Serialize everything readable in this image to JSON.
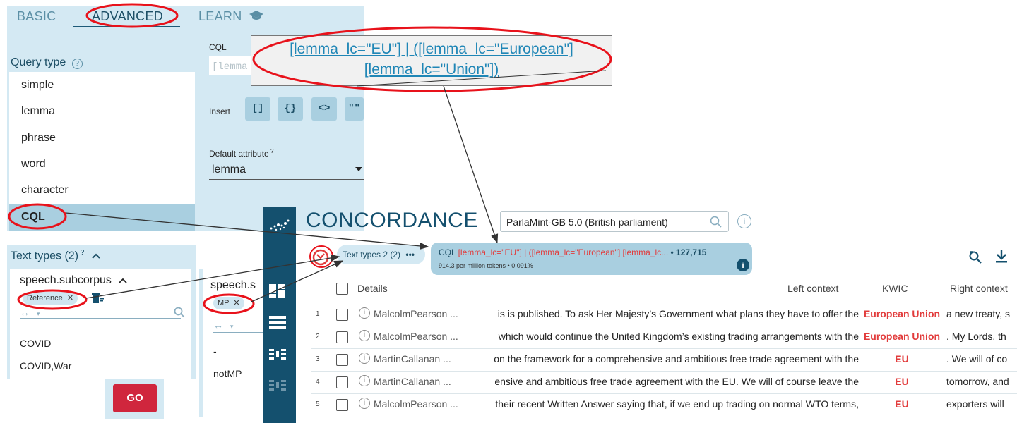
{
  "search_panel": {
    "tabs": [
      {
        "label": "BASIC"
      },
      {
        "label": "ADVANCED"
      },
      {
        "label": "LEARN"
      }
    ],
    "query_type_label": "Query type",
    "query_types": [
      "simple",
      "lemma",
      "phrase",
      "word",
      "character",
      "CQL"
    ],
    "selected_query_type": "CQL",
    "cql_label": "CQL",
    "cql_placeholder": "[lemma",
    "insert_label": "Insert",
    "insert_buttons": [
      "[]",
      "{}",
      "<>",
      "\"\""
    ],
    "default_attr_label": "Default attribute",
    "default_attr_value": "lemma"
  },
  "cql_overlay": {
    "line1": "[lemma_lc=\"EU\"] | ([lemma_lc=\"European\"]",
    "line2": "[lemma_lc=\"Union\"])"
  },
  "text_types": {
    "header": "Text types (2)",
    "attr1": "speech.subcorpus",
    "attr1_chip": "Reference",
    "attr1_values": [
      "COVID",
      "COVID,War"
    ],
    "attr2": "speech.s",
    "attr2_chip": "MP",
    "attr2_values": [
      "-",
      "notMP"
    ],
    "go_label": "GO"
  },
  "concordance": {
    "title": "CONCORDANCE",
    "corpus": "ParlaMint-GB 5.0 (British parliament)",
    "tt_pill": "Text types 2 (2)",
    "cql_prefix": "CQL",
    "cql_query": "[lemma_lc=\"EU\"] | ([lemma_lc=\"European\"] [lemma_lc...",
    "hits": "• 127,715",
    "freq": "914.3 per million tokens • 0.091%",
    "columns": {
      "details": "Details",
      "left": "Left context",
      "kwic": "KWIC",
      "right": "Right context"
    },
    "rows": [
      {
        "n": "1",
        "details": "MalcolmPearson ...",
        "left": "is is published. To ask Her Majesty’s Government what plans they have to offer the",
        "kwic": "European Union",
        "right": "a new treaty, s"
      },
      {
        "n": "2",
        "details": "MalcolmPearson ...",
        "left": "which would continue the United Kingdom’s existing trading arrangements with the",
        "kwic": "European Union",
        "right": ". My Lords, th"
      },
      {
        "n": "3",
        "details": "MartinCallanan ...",
        "left": "on the framework for a comprehensive and ambitious free trade agreement with the",
        "kwic": "EU",
        "right": ". We will of co"
      },
      {
        "n": "4",
        "details": "MartinCallanan ...",
        "left": "ensive and ambitious free trade agreement with the EU. We will of course leave the",
        "kwic": "EU",
        "right": "tomorrow, and"
      },
      {
        "n": "5",
        "details": "MalcolmPearson ...",
        "left": "their recent Written Answer saying that, if we end up trading on normal WTO terms,",
        "kwic": "EU",
        "right": "exporters will"
      }
    ]
  },
  "colors": {
    "accent": "#14506e",
    "highlight": "#e23c3c",
    "annotation": "#e8121b",
    "panel": "#d4e9f3"
  }
}
